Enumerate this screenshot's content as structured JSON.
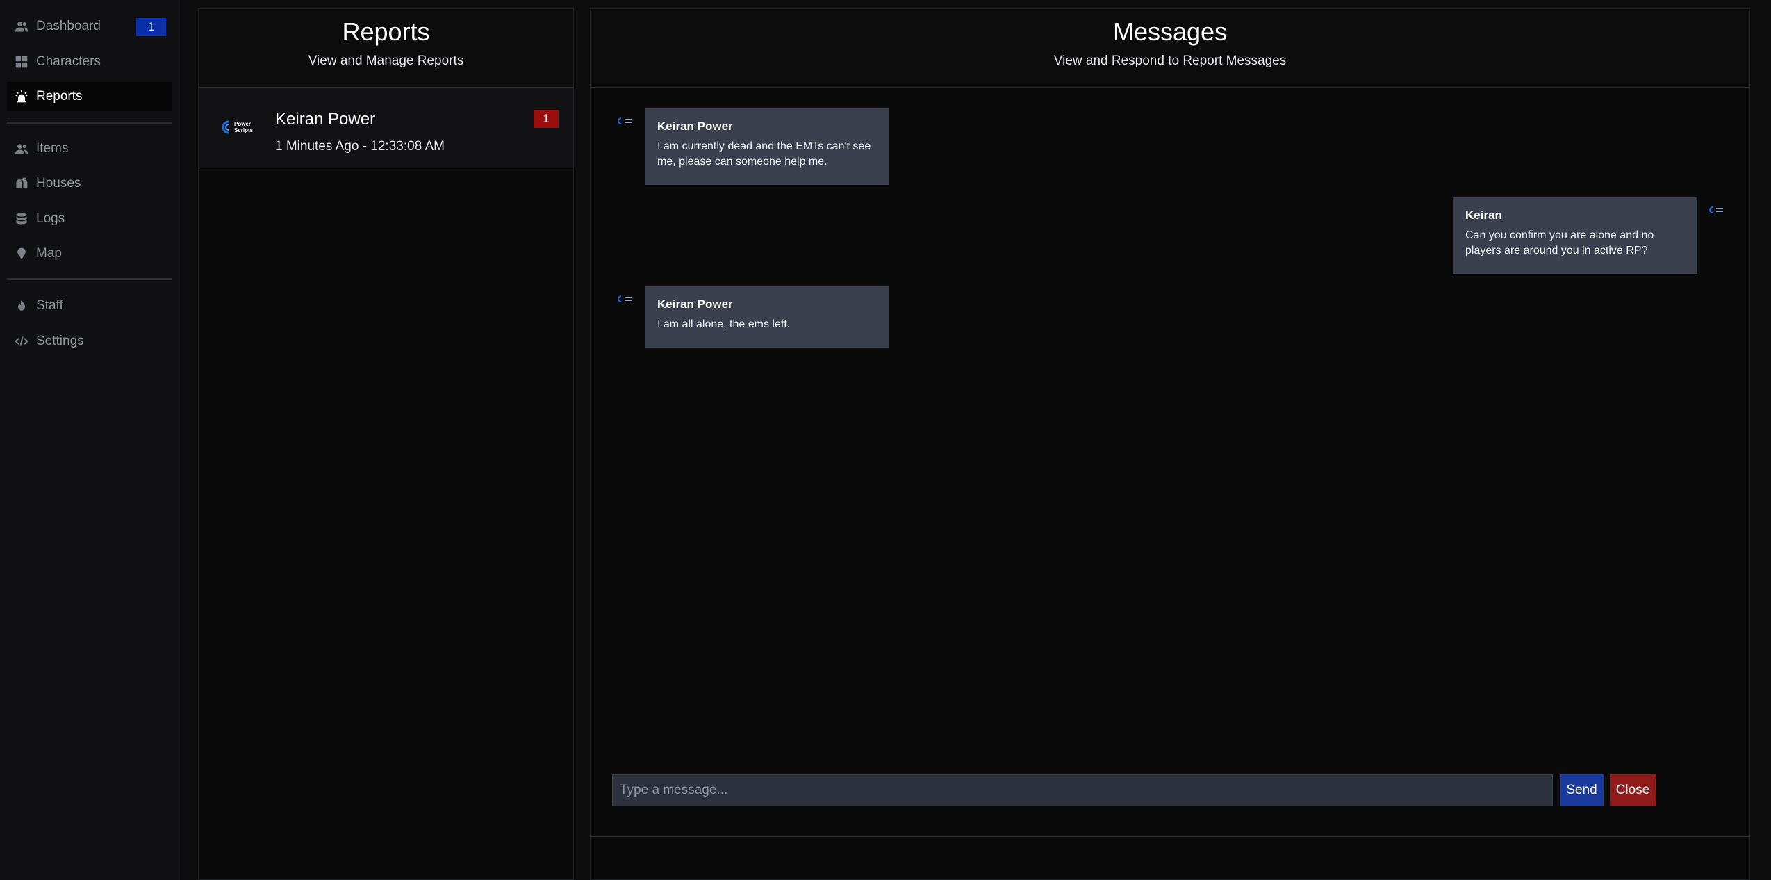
{
  "sidebar": {
    "items": [
      {
        "label": "Dashboard",
        "icon": "users-icon",
        "badge": "1"
      },
      {
        "label": "Characters",
        "icon": "grid-icon"
      },
      {
        "label": "Reports",
        "icon": "alarm-bell-icon",
        "active": true
      },
      {
        "label": "Items",
        "icon": "users-icon"
      },
      {
        "label": "Houses",
        "icon": "mailbox-icon"
      },
      {
        "label": "Logs",
        "icon": "database-icon"
      },
      {
        "label": "Map",
        "icon": "map-pin-icon"
      },
      {
        "label": "Staff",
        "icon": "flame-icon"
      },
      {
        "label": "Settings",
        "icon": "code-icon"
      }
    ]
  },
  "reports": {
    "title": "Reports",
    "subtitle": "View and Manage Reports",
    "list": [
      {
        "name": "Keiran Power",
        "time": "1 Minutes Ago - 12:33:08 AM",
        "badge": "1",
        "logo_text": [
          "Power",
          "Scripts"
        ]
      }
    ]
  },
  "messages": {
    "title": "Messages",
    "subtitle": "View and Respond to Report Messages",
    "thread": [
      {
        "author": "Keiran Power",
        "text": "I am currently dead and the EMTs can't see me, please can someone help me.",
        "side": "left"
      },
      {
        "author": "Keiran",
        "text": "Can you confirm you are alone and no players are around you in active RP?",
        "side": "right"
      },
      {
        "author": "Keiran Power",
        "text": "I am all alone, the ems left.",
        "side": "left"
      }
    ],
    "input_placeholder": "Type a message...",
    "send_label": "Send",
    "close_label": "Close"
  },
  "colors": {
    "accent_blue": "#0b2fa8",
    "badge_red": "#9b0e0e",
    "send_blue": "#1b3a9e",
    "close_red": "#8f1a1a",
    "bubble": "#3a404d"
  }
}
